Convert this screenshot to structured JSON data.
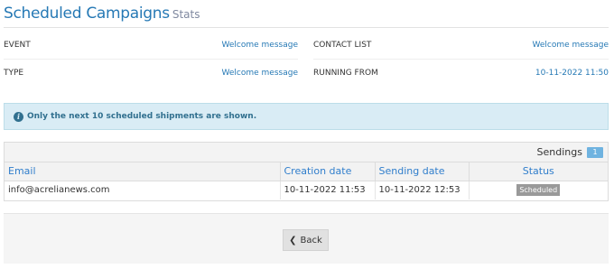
{
  "header": {
    "title": "Scheduled Campaigns",
    "subtitle": "Stats"
  },
  "info": {
    "event_label": "EVENT",
    "event_value": "Welcome message",
    "contact_list_label": "CONTACT LIST",
    "contact_list_value": "Welcome message",
    "type_label": "TYPE",
    "type_value": "Welcome message",
    "running_from_label": "RUNNING FROM",
    "running_from_value": "10-11-2022 11:50"
  },
  "alert": {
    "icon": "info-circle-icon",
    "text": "Only the next 10 scheduled shipments are shown."
  },
  "table": {
    "sendings_label": "Sendings",
    "sendings_count": "1",
    "columns": [
      "Email",
      "Creation date",
      "Sending date",
      "Status"
    ],
    "rows": [
      {
        "email": "info@acrelianews.com",
        "creation_date": "10-11-2022 11:53",
        "sending_date": "10-11-2022 12:53",
        "status": "Scheduled"
      }
    ]
  },
  "footer": {
    "back_label": "Back",
    "back_icon": "chevron-left-icon"
  },
  "colors": {
    "accent": "#2679b5",
    "alert_bg": "#d9ecf5",
    "badge": "#6fb3e0",
    "status_badge": "#999999"
  }
}
